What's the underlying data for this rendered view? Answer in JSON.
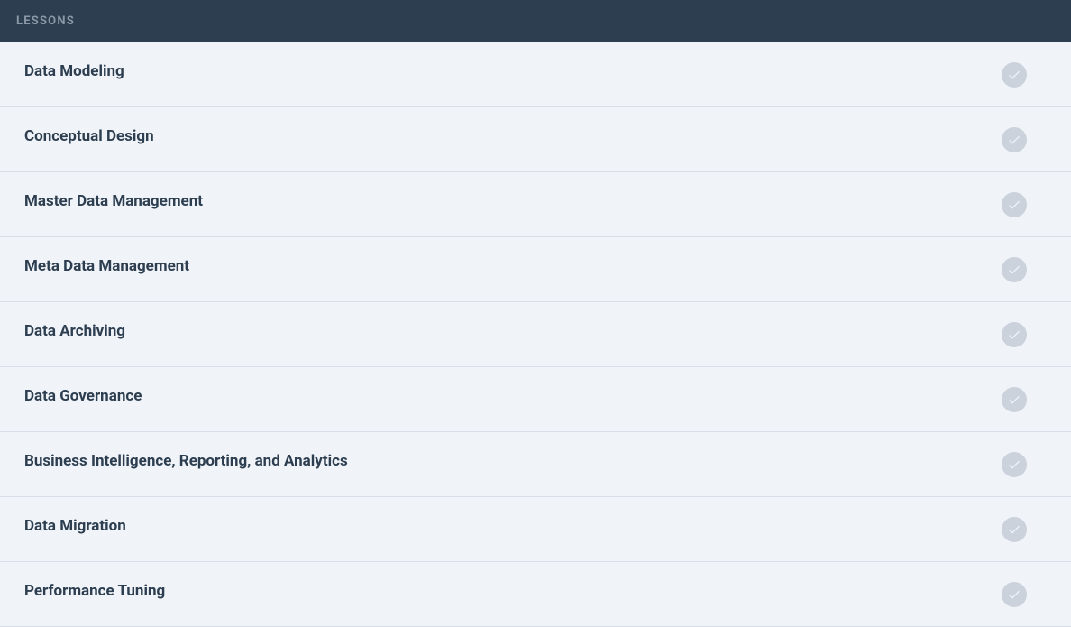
{
  "header": {
    "title": "LESSONS"
  },
  "lessons": [
    {
      "title": "Data Modeling"
    },
    {
      "title": "Conceptual Design"
    },
    {
      "title": "Master Data Management"
    },
    {
      "title": "Meta Data Management"
    },
    {
      "title": "Data Archiving"
    },
    {
      "title": "Data Governance"
    },
    {
      "title": "Business Intelligence, Reporting, and Analytics"
    },
    {
      "title": "Data Migration"
    },
    {
      "title": "Performance Tuning"
    }
  ]
}
